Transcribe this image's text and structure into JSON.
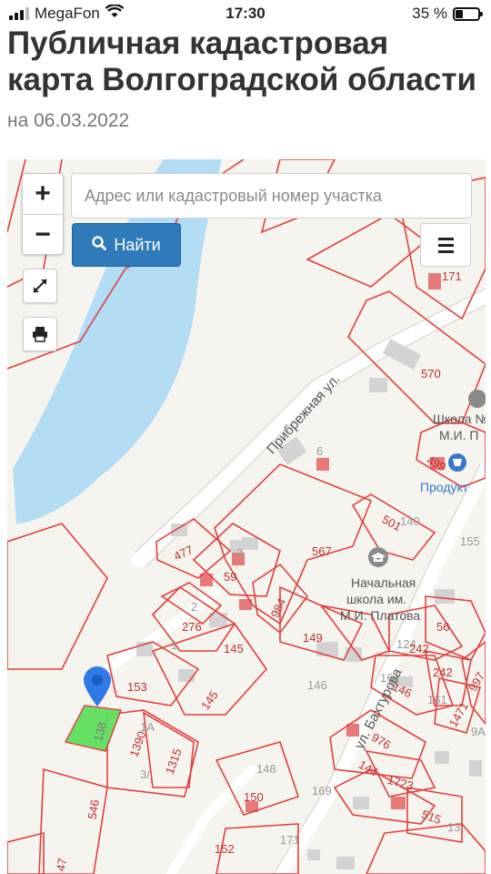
{
  "status_bar": {
    "carrier": "MegaFon",
    "time": "17:30",
    "battery": "35 %",
    "battery_level": 0.35
  },
  "page": {
    "title": "Публичная кадастровая карта Волгоградской области",
    "date": "на 06.03.2022"
  },
  "map_controls": {
    "zoom_in": "+",
    "zoom_out": "−",
    "search_placeholder": "Адрес или кадастровый номер участка",
    "find_label": "Найти",
    "icons": [
      "search-icon",
      "menu-icon",
      "fullscreen-icon",
      "print-icon",
      "map-pin-icon"
    ]
  },
  "map_labels": {
    "street_embankment": "Прибрежная ул.",
    "street_bakhturova": "ул. Бахтурова",
    "school_1": "Школа №",
    "school_2": "М.И. П",
    "shop": "Продукт",
    "school_primary_1": "Начальная",
    "school_primary_2": "школа им.",
    "school_primary_3": "М.И. Платова",
    "parcels": {
      "p171": "171",
      "p570": "570",
      "p6": "6",
      "p499": "499",
      "p501": "501",
      "p140": "140",
      "p155": "155",
      "p567": "567",
      "p477": "477",
      "p59": "59",
      "p984": "984",
      "p2": "2",
      "p2b": "2",
      "p276": "276",
      "p1": "1",
      "p145a": "145",
      "p145b": "145",
      "p153": "153",
      "p149": "149",
      "p146": "146",
      "p56": "56",
      "p124": "124",
      "p242a": "242",
      "p242b": "242",
      "p161": "161",
      "p146b": "146",
      "p161b": "161",
      "p1471": "1471",
      "p997": "997",
      "p9a": "9A",
      "p1390": "1390",
      "p1315": "1315",
      "p1a": "1А",
      "p3a": "3/",
      "p138": "138",
      "p148": "148",
      "p150": "150",
      "p169": "169",
      "p976": "976",
      "p144": "144",
      "p1723": "1723",
      "p515": "515",
      "p13": "13",
      "p546": "546",
      "p47": "47",
      "p171b": "171",
      "p152": "152"
    }
  }
}
